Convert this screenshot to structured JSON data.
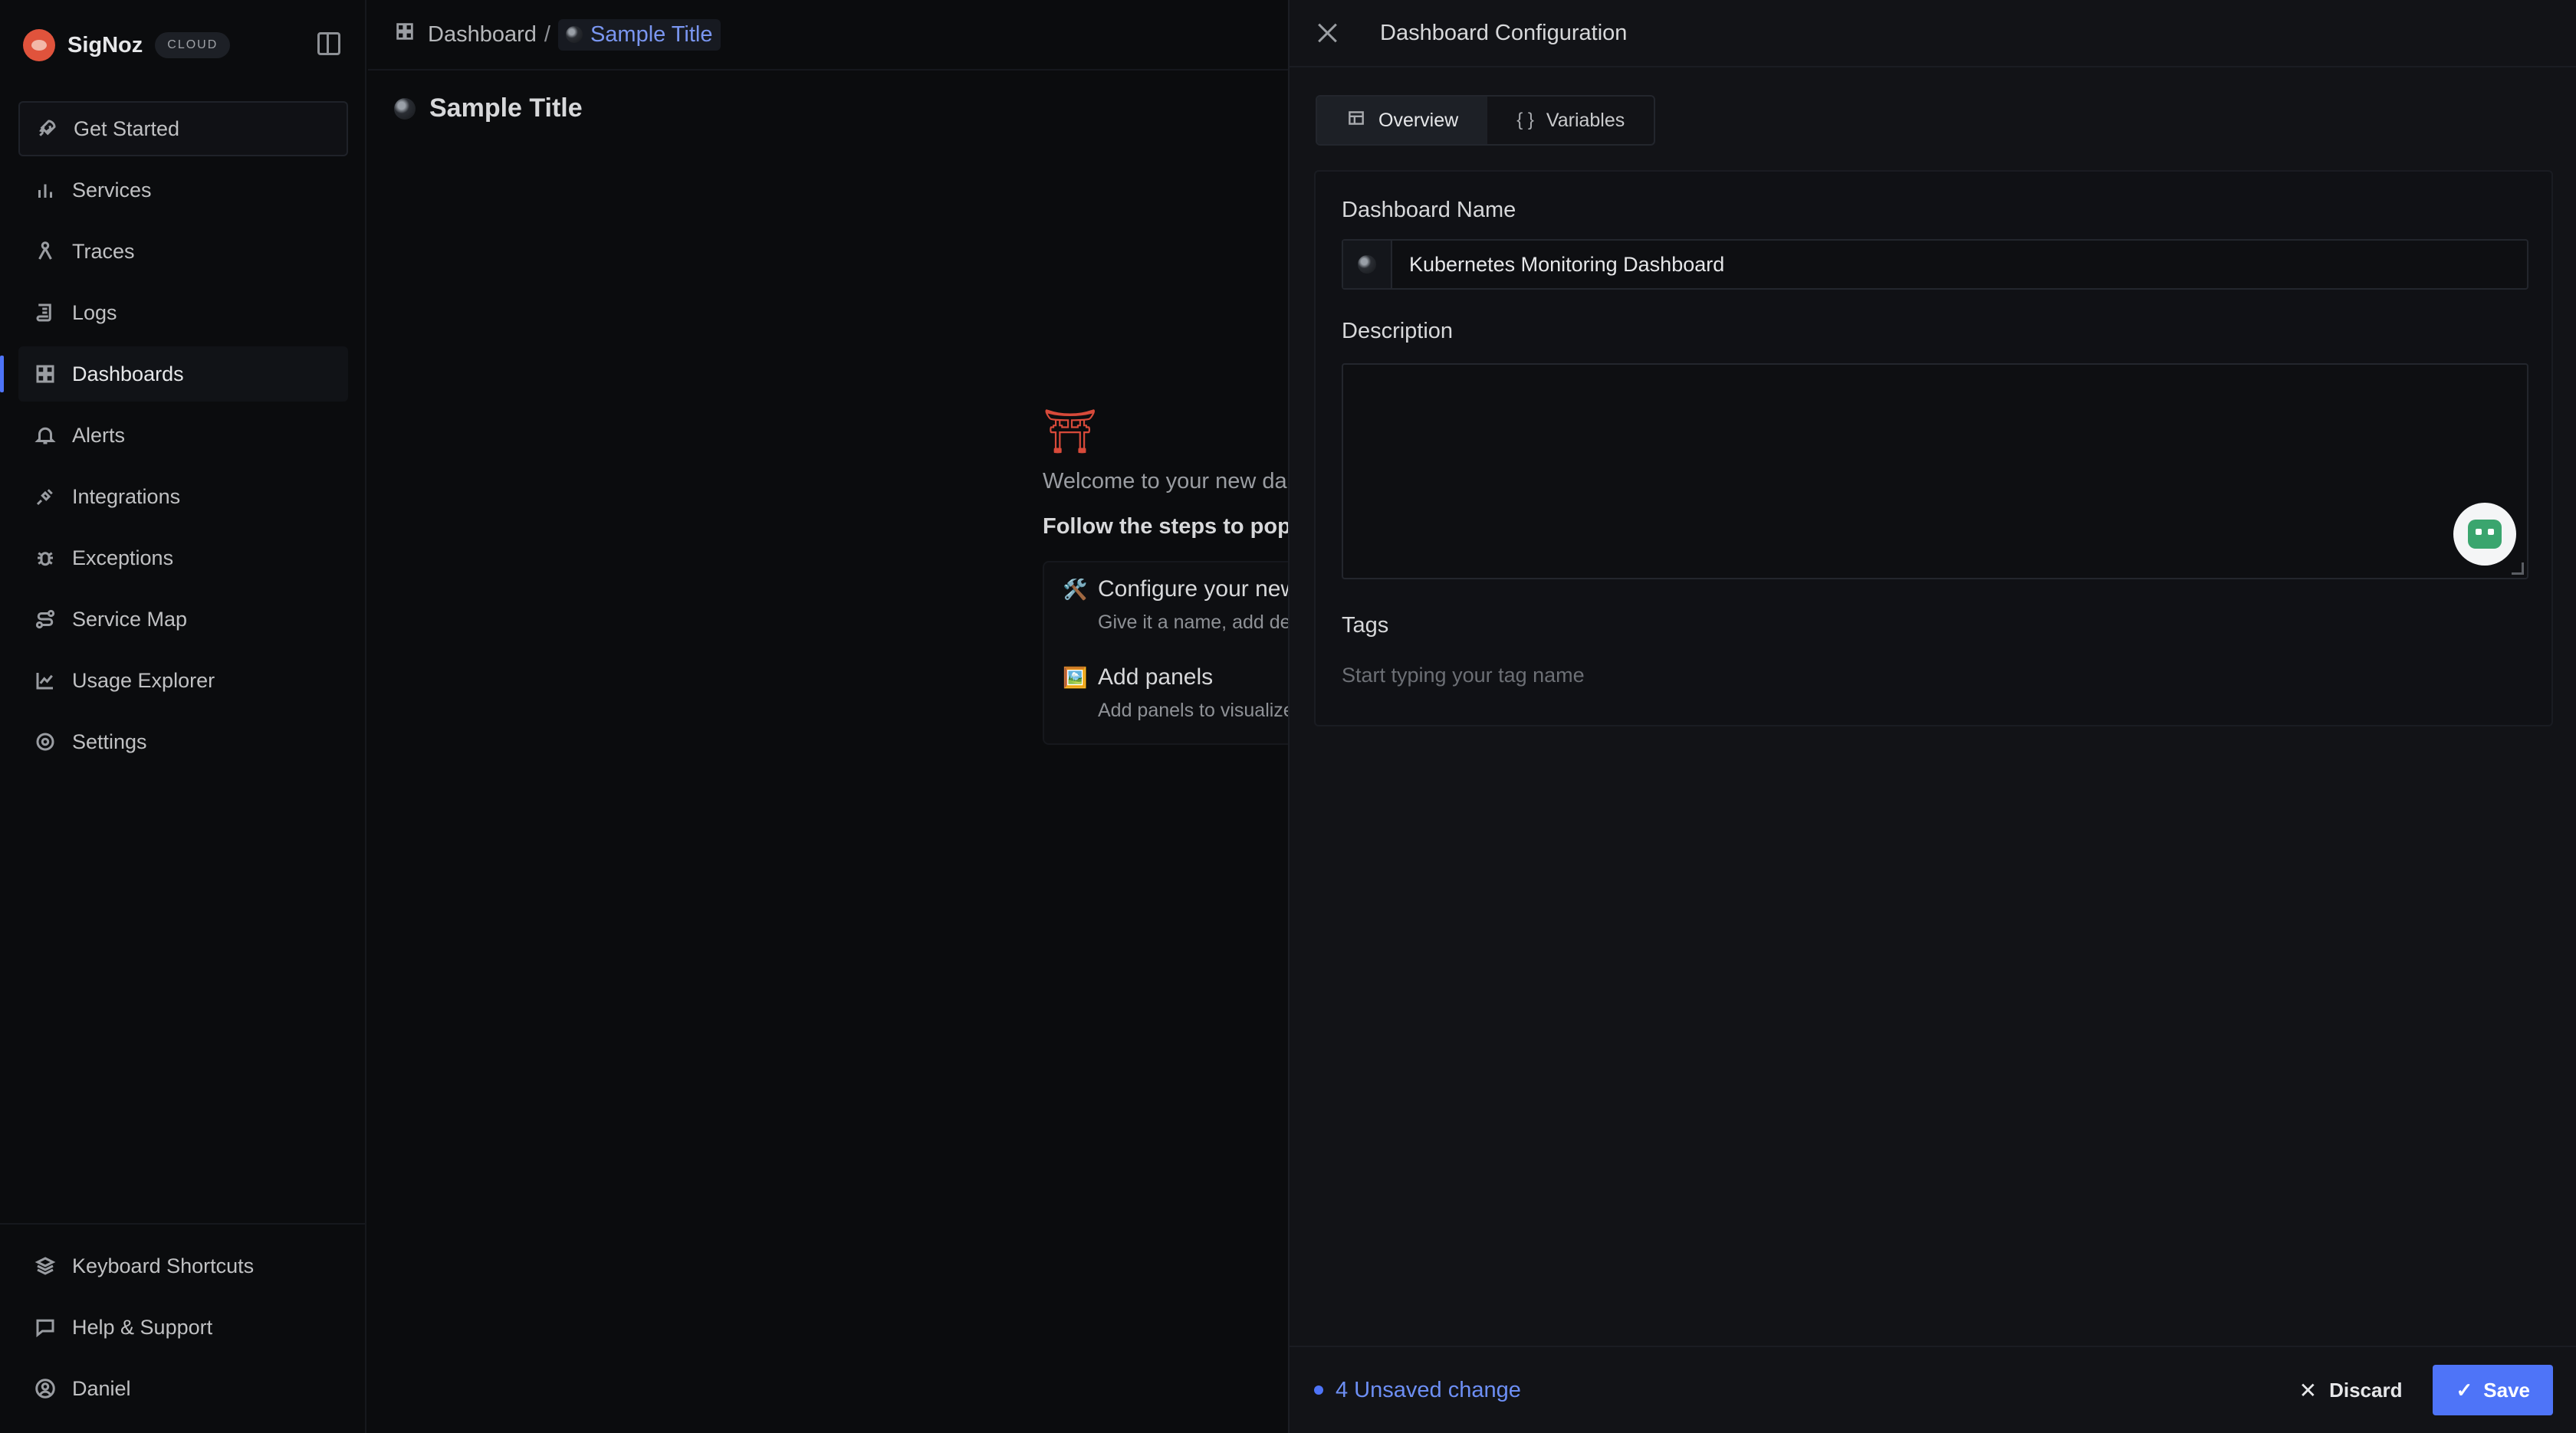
{
  "app": {
    "name": "SigNoz",
    "badge": "CLOUD"
  },
  "sidebar": {
    "items": [
      {
        "label": "Get Started"
      },
      {
        "label": "Services"
      },
      {
        "label": "Traces"
      },
      {
        "label": "Logs"
      },
      {
        "label": "Dashboards"
      },
      {
        "label": "Alerts"
      },
      {
        "label": "Integrations"
      },
      {
        "label": "Exceptions"
      },
      {
        "label": "Service Map"
      },
      {
        "label": "Usage Explorer"
      },
      {
        "label": "Settings"
      }
    ],
    "footer": [
      {
        "label": "Keyboard Shortcuts"
      },
      {
        "label": "Help & Support"
      },
      {
        "label": "Daniel"
      }
    ]
  },
  "breadcrumb": {
    "root": "Dashboard",
    "separator": "/",
    "current": "Sample Title"
  },
  "page": {
    "title": "Sample Title",
    "welcome": "Welcome to your new da",
    "follow": "Follow the steps to popu",
    "steps": [
      {
        "emoji": "🛠️",
        "title": "Configure your new",
        "desc": "Give it a name, add de"
      },
      {
        "emoji": "🖼️",
        "title": "Add panels",
        "desc": "Add panels to visualize"
      }
    ]
  },
  "drawer": {
    "title": "Dashboard Configuration",
    "tabs": [
      {
        "label": "Overview"
      },
      {
        "label": "Variables"
      }
    ],
    "name_label": "Dashboard Name",
    "name_value": "Kubernetes Monitoring Dashboard",
    "description_label": "Description",
    "description_value": "",
    "tags_label": "Tags",
    "tags_placeholder": "Start typing your tag name",
    "unsaved": "4 Unsaved change",
    "discard": "Discard",
    "save": "Save"
  },
  "colors": {
    "accent": "#4e74f8",
    "background": "#0b0c0e",
    "drawer": "#121317"
  }
}
